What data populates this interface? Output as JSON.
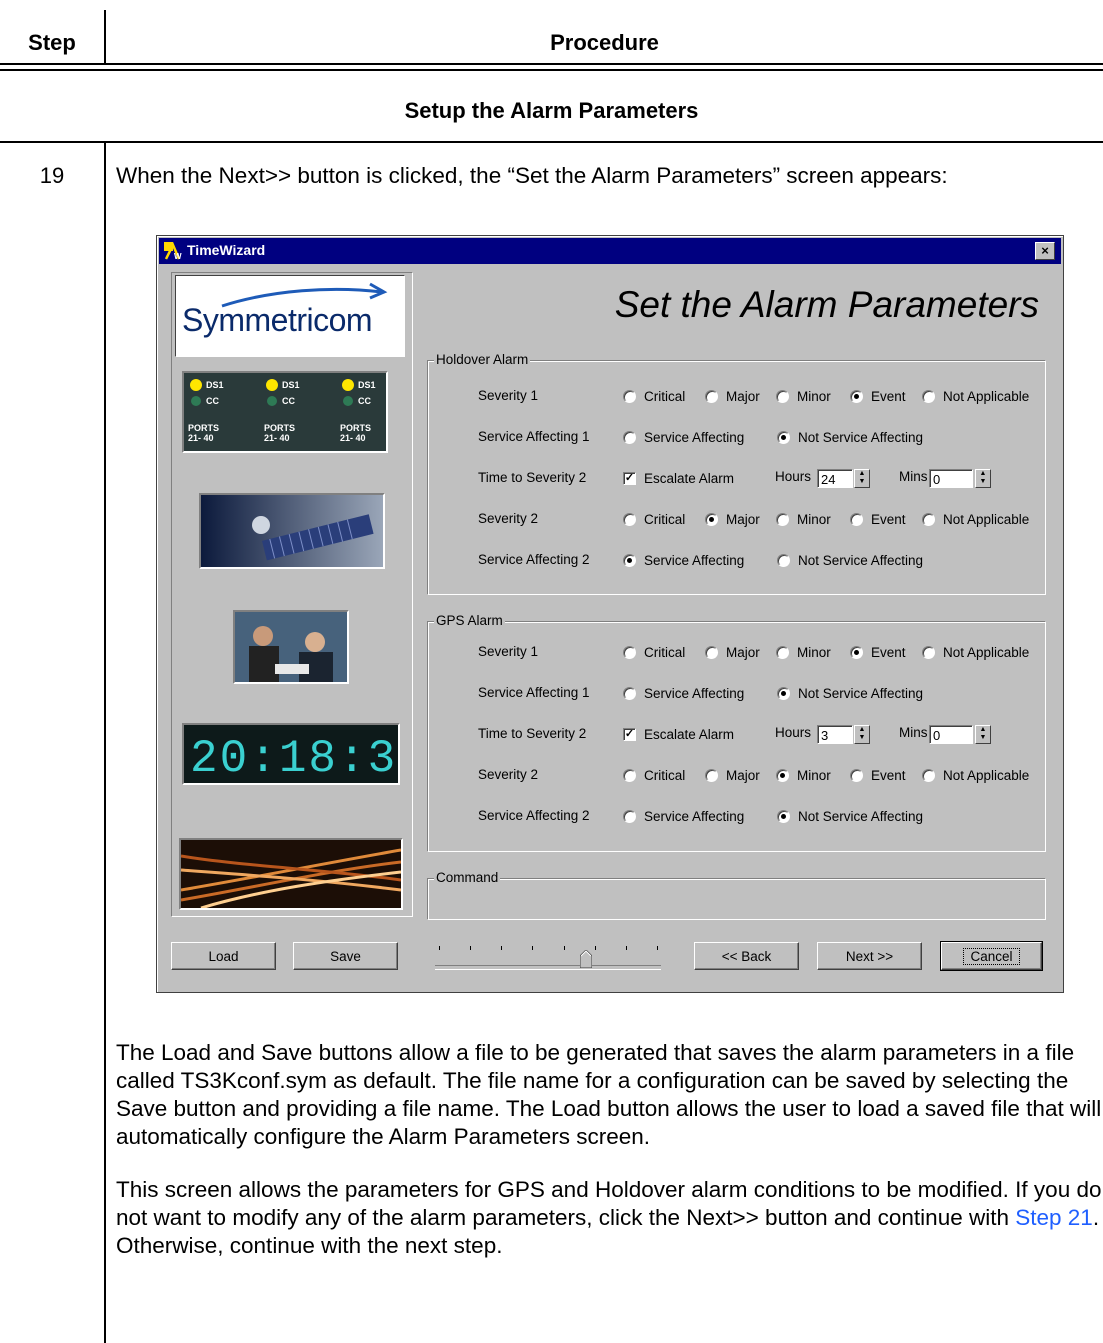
{
  "table": {
    "header_step": "Step",
    "header_procedure": "Procedure",
    "section_title": "Setup the Alarm Parameters",
    "step_number": "19",
    "intro": "When the Next>> button is clicked, the “Set the Alarm Parameters” screen appears:",
    "para1": "The Load and Save buttons allow a file to be generated that saves the alarm parameters in a file called TS3Kconf.sym as default. The file name for a configuration can be saved by selecting the Save button and providing a file name. The Load button allows the user to load a saved file that will automatically configure the Alarm Parameters screen.",
    "para2_before": "This screen allows the parameters for GPS and Holdover alarm conditions to be modified. If you do not want to modify any of the alarm parameters, click the Next>> button and continue with ",
    "para2_link": "Step 21",
    "para2_after": ". Otherwise, continue with the next step."
  },
  "window": {
    "title": "TimeWizard",
    "close": "×",
    "heading": "Set the Alarm Parameters",
    "logo_text": "Symmetricom",
    "port_labels": [
      "DS1",
      "CC",
      "PORTS",
      "21- 40"
    ],
    "clock_text": "20:18:3"
  },
  "holdover": {
    "title": "Holdover Alarm",
    "severity1": {
      "label": "Severity 1",
      "selected": "Event"
    },
    "service1": {
      "label": "Service Affecting 1",
      "selected": "Not Service Affecting"
    },
    "time": {
      "label": "Time to Severity 2",
      "escalate": "Escalate Alarm",
      "escalate_checked": true,
      "hours_label": "Hours",
      "hours": "24",
      "mins_label": "Mins",
      "mins": "0"
    },
    "severity2": {
      "label": "Severity 2",
      "selected": "Major"
    },
    "service2": {
      "label": "Service Affecting 2",
      "selected": "Service Affecting"
    }
  },
  "gps": {
    "title": "GPS Alarm",
    "severity1": {
      "label": "Severity 1",
      "selected": "Event"
    },
    "service1": {
      "label": "Service Affecting 1",
      "selected": "Not Service Affecting"
    },
    "time": {
      "label": "Time to Severity 2",
      "escalate": "Escalate Alarm",
      "escalate_checked": true,
      "hours_label": "Hours",
      "hours": "3",
      "mins_label": "Mins",
      "mins": "0"
    },
    "severity2": {
      "label": "Severity 2",
      "selected": "Minor"
    },
    "service2": {
      "label": "Service Affecting 2",
      "selected": "Not Service Affecting"
    }
  },
  "severity_options": [
    "Critical",
    "Major",
    "Minor",
    "Event",
    "Not Applicable"
  ],
  "service_options": [
    "Service Affecting",
    "Not Service Affecting"
  ],
  "command": {
    "title": "Command"
  },
  "buttons": {
    "load": "Load",
    "save": "Save",
    "back": "<< Back",
    "next": "Next >>",
    "cancel": "Cancel"
  },
  "slider": {
    "ticks": 8,
    "position": 6
  }
}
